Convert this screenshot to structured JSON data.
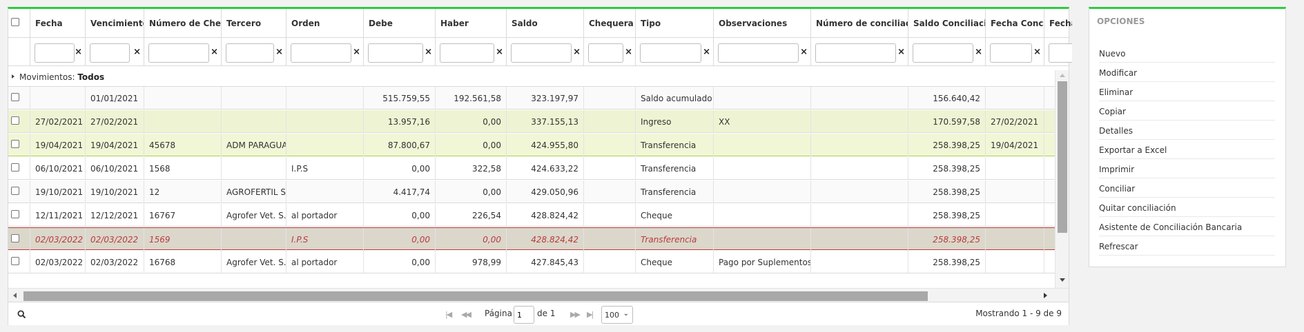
{
  "columns": [
    "Fecha",
    "Vencimiento",
    "Número de Cheque",
    "Tercero",
    "Orden",
    "Debe",
    "Haber",
    "Saldo",
    "Chequera",
    "Tipo",
    "Observaciones",
    "Número de conciliación",
    "Saldo Conciliación",
    "Fecha Conciliación",
    "Fecha"
  ],
  "filter_clear": "×",
  "group": {
    "label": "Movimientos:",
    "value": "Todos"
  },
  "rows": [
    {
      "fecha": "",
      "venc": "01/01/2021",
      "cheque": "",
      "tercero": "",
      "orden": "",
      "debe": "515.759,55",
      "haber": "192.561,58",
      "saldo": "323.197,97",
      "chequera": "",
      "tipo": "Saldo acumulado",
      "obs": "",
      "ncon": "",
      "scon": "156.640,42",
      "fcon": ""
    },
    {
      "fecha": "27/02/2021",
      "venc": "27/02/2021",
      "cheque": "",
      "tercero": "",
      "orden": "",
      "debe": "13.957,16",
      "haber": "0,00",
      "saldo": "337.155,13",
      "chequera": "",
      "tipo": "Ingreso",
      "obs": "XX",
      "ncon": "",
      "scon": "170.597,58",
      "fcon": "27/02/2021"
    },
    {
      "fecha": "19/04/2021",
      "venc": "19/04/2021",
      "cheque": "45678",
      "tercero": "ADM PARAGUAYA",
      "orden": "",
      "debe": "87.800,67",
      "haber": "0,00",
      "saldo": "424.955,80",
      "chequera": "",
      "tipo": "Transferencia",
      "obs": "",
      "ncon": "",
      "scon": "258.398,25",
      "fcon": "19/04/2021"
    },
    {
      "fecha": "06/10/2021",
      "venc": "06/10/2021",
      "cheque": "1568",
      "tercero": "",
      "orden": "I.P.S",
      "debe": "0,00",
      "haber": "322,58",
      "saldo": "424.633,22",
      "chequera": "",
      "tipo": "Transferencia",
      "obs": "",
      "ncon": "",
      "scon": "258.398,25",
      "fcon": ""
    },
    {
      "fecha": "19/10/2021",
      "venc": "19/10/2021",
      "cheque": "12",
      "tercero": "AGROFERTIL S.A.",
      "orden": "",
      "debe": "4.417,74",
      "haber": "0,00",
      "saldo": "429.050,96",
      "chequera": "",
      "tipo": "Transferencia",
      "obs": "",
      "ncon": "",
      "scon": "258.398,25",
      "fcon": ""
    },
    {
      "fecha": "12/11/2021",
      "venc": "12/12/2021",
      "cheque": "16767",
      "tercero": "Agrofer Vet. S.R.L.",
      "orden": "al portador",
      "debe": "0,00",
      "haber": "226,54",
      "saldo": "428.824,42",
      "chequera": "",
      "tipo": "Cheque",
      "obs": "",
      "ncon": "",
      "scon": "258.398,25",
      "fcon": ""
    },
    {
      "fecha": "02/03/2022",
      "venc": "02/03/2022",
      "cheque": "1569",
      "tercero": "",
      "orden": "I.P.S",
      "debe": "0,00",
      "haber": "0,00",
      "saldo": "428.824,42",
      "chequera": "",
      "tipo": "Transferencia",
      "obs": "",
      "ncon": "",
      "scon": "258.398,25",
      "fcon": ""
    },
    {
      "fecha": "02/03/2022",
      "venc": "02/03/2022",
      "cheque": "16768",
      "tercero": "Agrofer Vet. S.R.L.",
      "orden": "al portador",
      "debe": "0,00",
      "haber": "978,99",
      "saldo": "427.845,43",
      "chequera": "",
      "tipo": "Cheque",
      "obs": "Pago por Suplementos",
      "ncon": "",
      "scon": "258.398,25",
      "fcon": ""
    }
  ],
  "pager": {
    "page_label": "Página",
    "page_value": "1",
    "of_label": "de 1",
    "page_size": "100",
    "showing": "Mostrando 1 - 9 de 9"
  },
  "options": {
    "title": "OPCIONES",
    "items": [
      "Nuevo",
      "Modificar",
      "Eliminar",
      "Copiar",
      "Detalles",
      "Exportar a Excel",
      "Imprimir",
      "Conciliar",
      "Quitar conciliación",
      "Asistente de Conciliación Bancaria",
      "Refrescar"
    ]
  },
  "colors": {
    "accent": "#2ecc40",
    "selected_text": "#b83c3c",
    "highlight": "#eef4d3"
  }
}
